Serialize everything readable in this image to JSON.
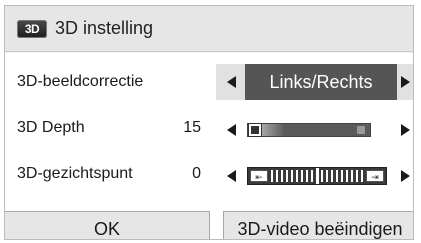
{
  "dialog": {
    "logo_text": "3D",
    "title": "3D instelling"
  },
  "rows": {
    "correction": {
      "label": "3D-beeldcorrectie",
      "value": "Links/Rechts"
    },
    "depth": {
      "label": "3D Depth",
      "value": "15",
      "level_fraction": 0.0
    },
    "viewpoint": {
      "label": "3D-gezichtspunt",
      "value": "0",
      "level_fraction": 0.5
    }
  },
  "buttons": {
    "ok": "OK",
    "end_3d": "3D-video beëindigen"
  },
  "colors": {
    "selected_value_bg": "#555555",
    "panel_bg": "#ffffff",
    "titlebar_bg": "#e6e6e6"
  },
  "icons": {
    "logo": "3d-logo-icon",
    "left": "arrow-left-icon",
    "right": "arrow-right-icon"
  }
}
